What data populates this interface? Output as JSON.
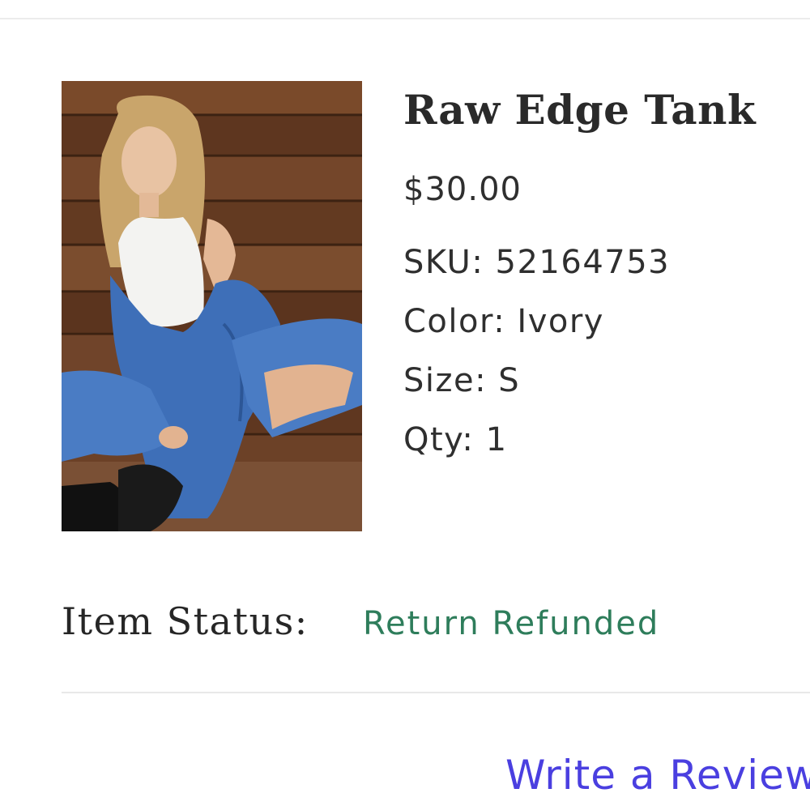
{
  "product": {
    "title": "Raw Edge Tank",
    "price": "$30.00",
    "details": [
      "SKU: 52164753",
      "Color: Ivory",
      "Size: S",
      "Qty: 1"
    ]
  },
  "status": {
    "label": "Item Status:",
    "value": "Return Refunded",
    "value_color": "#2e7d5b"
  },
  "actions": {
    "review_label": "Write a Review",
    "link_color": "#4a3fe0"
  }
}
